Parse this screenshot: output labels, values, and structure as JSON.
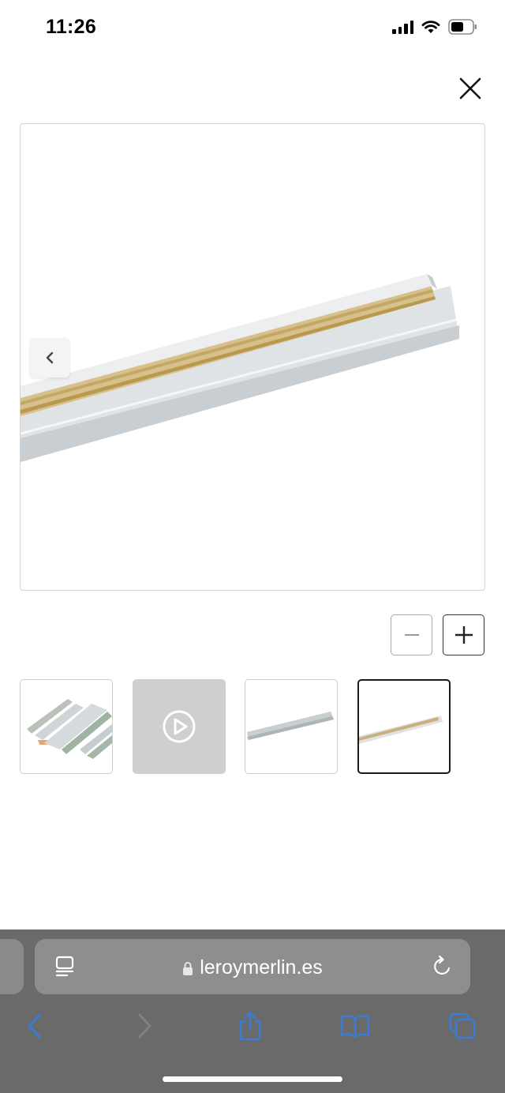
{
  "status_bar": {
    "time": "11:26"
  },
  "gallery": {
    "close_icon": "close-icon",
    "prev_icon": "chevron-left-icon",
    "zoom_out_icon": "minus-icon",
    "zoom_in_icon": "plus-icon",
    "thumbnails": [
      {
        "kind": "image",
        "selected": false,
        "subject": "wood-strips"
      },
      {
        "kind": "video",
        "selected": false,
        "icon": "play-icon"
      },
      {
        "kind": "image",
        "selected": false,
        "subject": "grey-strip"
      },
      {
        "kind": "image",
        "selected": true,
        "subject": "strip-with-adhesive"
      }
    ]
  },
  "browser": {
    "url": "leroymerlin.es",
    "reader_icon": "reader-icon",
    "lock_icon": "lock-icon",
    "reload_icon": "reload-icon",
    "toolbar": [
      "back-icon",
      "forward-icon",
      "share-icon",
      "bookmarks-icon",
      "tabs-icon"
    ]
  },
  "colors": {
    "accent": "#3a7bd5",
    "browser_bar": "#6a6a6a",
    "url_field": "#8e8e8e",
    "selected_border": "#1a1a1a"
  }
}
